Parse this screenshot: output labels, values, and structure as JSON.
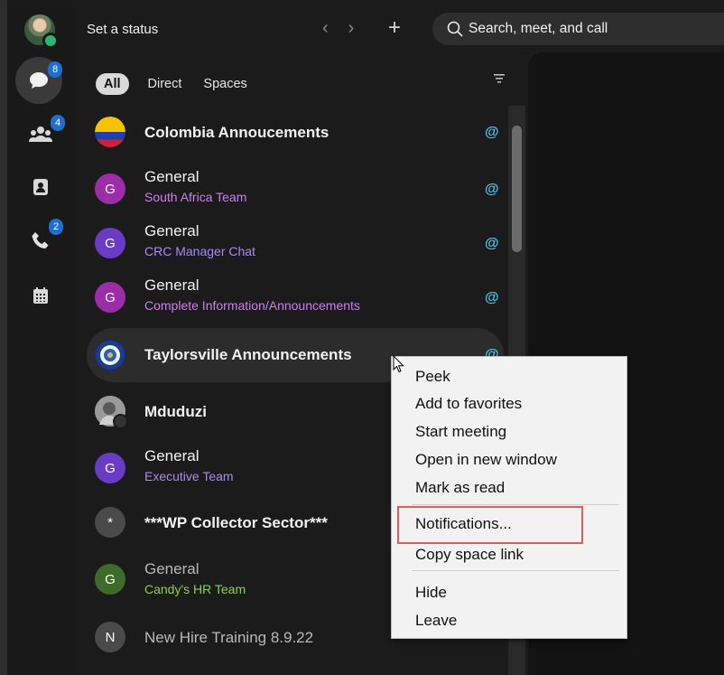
{
  "topbar": {
    "status_label": "Set a status",
    "search_placeholder": "Search, meet, and call"
  },
  "rail": {
    "messages_badge": "8",
    "teams_badge": "4",
    "calls_badge": "2"
  },
  "tabs": [
    {
      "label": "All",
      "active": true
    },
    {
      "label": "Direct",
      "active": false
    },
    {
      "label": "Spaces",
      "active": false
    }
  ],
  "spaces": [
    {
      "title": "Colombia Annoucements",
      "subtitle": "",
      "avatar": "flag",
      "mention": true
    },
    {
      "title": "General",
      "subtitle": "South Africa Team",
      "avatar": "G",
      "avatar_color": "#9b2ea6",
      "sub_color": "#c981e6",
      "mention": true
    },
    {
      "title": "General",
      "subtitle": "CRC Manager Chat",
      "avatar": "G",
      "avatar_color": "#6a3bc4",
      "sub_color": "#a98af0",
      "mention": true
    },
    {
      "title": "General",
      "subtitle": "Complete Information/Announcements",
      "avatar": "G",
      "avatar_color": "#9b2ea6",
      "sub_color": "#c981e6",
      "mention": true
    },
    {
      "title": "Taylorsville Announcements",
      "subtitle": "",
      "avatar": "seal",
      "mention": true
    },
    {
      "title": "Mduduzi",
      "subtitle": "",
      "avatar": "photo",
      "mention": false
    },
    {
      "title": "General",
      "subtitle": "Executive Team",
      "avatar": "G",
      "avatar_color": "#6a3bc4",
      "sub_color": "#a98af0",
      "mention": false
    },
    {
      "title": "***WP Collector Sector***",
      "subtitle": "",
      "avatar": "*",
      "avatar_color": "#4a4a4a",
      "mention": false
    },
    {
      "title": "General",
      "subtitle": "Candy's HR Team",
      "avatar": "G",
      "avatar_color": "#3f6b2a",
      "sub_color": "#8fcf4a",
      "mention": false
    },
    {
      "title": "New Hire Training 8.9.22",
      "subtitle": "",
      "avatar": "N",
      "avatar_color": "#4a4a4a",
      "mention": false
    }
  ],
  "context_menu": {
    "items": [
      "Peek",
      "Add to favorites",
      "Start meeting",
      "Open in new window",
      "Mark as read",
      "Notifications...",
      "Copy space link",
      "Hide",
      "Leave"
    ],
    "highlighted": "Notifications..."
  },
  "colors": {
    "accent": "#4fc3e8",
    "badge": "#1f6fd1",
    "highlight": "#e35a5a"
  }
}
